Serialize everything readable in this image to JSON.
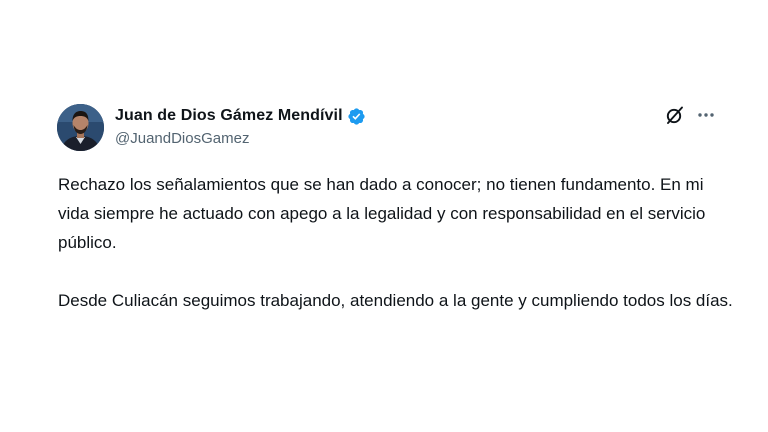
{
  "author": {
    "display_name": "Juan de Dios Gámez Mendívil",
    "handle": "@JuandDiosGamez",
    "verified": true,
    "avatar_icon": "profile-photo"
  },
  "actions": {
    "grok_icon": "grok-icon",
    "more_icon": "more-options-icon"
  },
  "tweet": {
    "paragraphs": [
      "Rechazo los señalamientos que se han dado a conocer; no tienen fundamento. En mi vida siempre he actuado con apego a la legalidad y con responsabilidad en el servicio público.",
      "Desde Culiacán seguimos trabajando, atendiendo a la gente y cumpliendo todos los días."
    ]
  },
  "colors": {
    "text": "#0f1419",
    "secondary": "#536471",
    "verified": "#1d9bf0"
  }
}
